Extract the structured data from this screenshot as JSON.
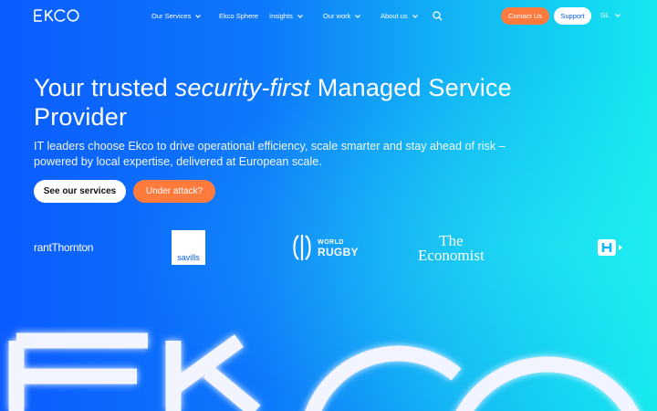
{
  "header": {
    "brand": "EKCO",
    "nav": [
      {
        "label": "Our Services",
        "has_dropdown": true
      },
      {
        "label": "Ekco Sphere",
        "has_dropdown": false
      },
      {
        "label": "Insights",
        "has_dropdown": true
      },
      {
        "label": "Our work",
        "has_dropdown": true
      },
      {
        "label": "About us",
        "has_dropdown": true
      }
    ],
    "search_icon": "search-icon",
    "contact_label": "Contact Us",
    "support_label": "Support",
    "language": "GL"
  },
  "hero": {
    "headline_pre": "Your trusted ",
    "headline_em": "security-first",
    "headline_post": " Managed Service Provider",
    "subtext": "IT leaders choose Ekco to drive operational efficiency, scale smarter and stay ahead of risk – powered by local expertise, delivered at European scale.",
    "primary_cta": "See our services",
    "secondary_cta": "Under attack?"
  },
  "clients": {
    "grant_thornton": "rantThornton",
    "savills": "savills",
    "world_rugby_top": "WORLD",
    "world_rugby_bottom": "RUGBY",
    "economist_top": "The",
    "economist_bottom": "Economist"
  },
  "colors": {
    "accent_orange": "#ff7a3d",
    "brand_blue": "#0a5cff",
    "gradient_end": "#14e8ef"
  }
}
